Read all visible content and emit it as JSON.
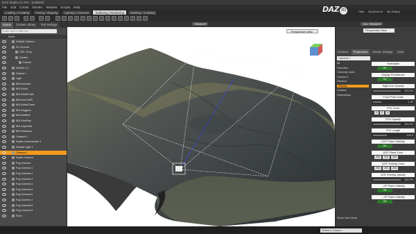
{
  "window": {
    "title": "DAZ Studio 4.x Pro - (untitled)"
  },
  "menu": [
    "File",
    "Edit",
    "Create",
    "Render",
    "Window",
    "Scripts",
    "Help"
  ],
  "main_tabs": [
    {
      "label": "Loading | Creating",
      "active": false
    },
    {
      "label": "Posing | Shaping",
      "active": false
    },
    {
      "label": "Lighting | Cameras",
      "active": false
    },
    {
      "label": "Surfacing | Rendering",
      "active": true
    },
    {
      "label": "Building | Scripting",
      "active": false
    }
  ],
  "logo": {
    "text": "DAZ",
    "badge": "3D"
  },
  "account": [
    "Help",
    "My Account",
    "My Gallery"
  ],
  "left_panel": {
    "tabs": [
      {
        "label": "Scene",
        "active": true
      },
      {
        "label": "Content Library",
        "active": false
      },
      {
        "label": "Tool Settings",
        "active": false
      }
    ],
    "filter_placeholder": "Enter text to filter by...",
    "header": "Node",
    "items": [
      {
        "label": "Default Camera",
        "indent": 1,
        "selected": false
      },
      {
        "label": "GL-Ground",
        "indent": 1,
        "selected": false
      },
      {
        "label": "CRT_Prop",
        "indent": 2,
        "selected": false
      },
      {
        "label": "Cavern",
        "indent": 2,
        "selected": false
      },
      {
        "label": "Cavern",
        "indent": 3,
        "selected": false
      },
      {
        "label": "Vehicle 4.2",
        "indent": 1,
        "selected": false
      },
      {
        "label": "Distant L",
        "indent": 1,
        "selected": false
      },
      {
        "label": "Light",
        "indent": 1,
        "selected": false
      },
      {
        "label": "IBS-Helmets",
        "indent": 1,
        "selected": false
      },
      {
        "label": "IBS-Scroll",
        "indent": 1,
        "selected": false
      },
      {
        "label": "IBS-DetailCuffL",
        "indent": 1,
        "selected": false
      },
      {
        "label": "IBS-ArmCuffR",
        "indent": 1,
        "selected": false
      },
      {
        "label": "IBS-DetailChest",
        "indent": 1,
        "selected": false
      },
      {
        "label": "IBS-Daggers",
        "indent": 1,
        "selected": false
      },
      {
        "label": "IBS-BeltBelt",
        "indent": 1,
        "selected": false
      },
      {
        "label": "IBS-ShinPad",
        "indent": 1,
        "selected": false
      },
      {
        "label": "IBS-CapeHair",
        "indent": 1,
        "selected": false
      },
      {
        "label": "IBS-Shadows",
        "indent": 1,
        "selected": false
      },
      {
        "label": "Camera 0",
        "indent": 1,
        "selected": false
      },
      {
        "label": "Depth-Commanded 1",
        "indent": 1,
        "selected": false
      },
      {
        "label": "Default Light 1",
        "indent": 1,
        "selected": false
      },
      {
        "label": "Camera 1",
        "indent": 1,
        "selected": true
      },
      {
        "label": "Depth Camera",
        "indent": 1,
        "selected": false
      },
      {
        "label": "Fog Camera",
        "indent": 1,
        "selected": false
      },
      {
        "label": "Fog Camera 1",
        "indent": 1,
        "selected": false
      },
      {
        "label": "Fog Camera 2",
        "indent": 1,
        "selected": false
      },
      {
        "label": "Fog Camera 3",
        "indent": 1,
        "selected": false
      },
      {
        "label": "Fog Camera 4",
        "indent": 1,
        "selected": false
      },
      {
        "label": "Fog Camera 5",
        "indent": 1,
        "selected": false
      },
      {
        "label": "Fog Camera 6",
        "indent": 1,
        "selected": false
      },
      {
        "label": "Fog Camera 7",
        "indent": 1,
        "selected": false
      },
      {
        "label": "Fog Camera 8",
        "indent": 1,
        "selected": false
      },
      {
        "label": "Fog Camera 9",
        "indent": 1,
        "selected": false
      },
      {
        "label": "Rock",
        "indent": 1,
        "selected": false
      }
    ]
  },
  "viewport": {
    "title": "Viewport",
    "view_select": "Perspective View"
  },
  "right_panel": {
    "title": "Aux Viewport",
    "view_select": "Perspective View",
    "tabs": [
      {
        "label": "Surfaces",
        "active": false
      },
      {
        "label": "Parameters",
        "active": true
      },
      {
        "label": "Render Settings",
        "active": false
      },
      {
        "label": "Anim",
        "active": false
      }
    ],
    "camera_select": "Camera 1",
    "categories": [
      {
        "label": "All",
        "sel": false
      },
      {
        "label": "Favorites",
        "sel": false
      },
      {
        "label": "Currently Used",
        "sel": false
      },
      {
        "label": "Camera 1",
        "sel": false
      },
      {
        "label": "General",
        "sel": false
      },
      {
        "label": "Display",
        "sel": true
      },
      {
        "label": "Camera",
        "sel": false
      },
      {
        "label": "Dimensions",
        "sel": false
      }
    ],
    "properties": [
      {
        "label": "Selectable",
        "kind": "toggle",
        "value": "On"
      },
      {
        "label": "Display Persistence",
        "kind": "toggle",
        "value": "On"
      },
      {
        "label": "Sight Line Opacity",
        "kind": "slider",
        "value": "100.0%",
        "level": 1.0
      },
      {
        "label": "Focal Point Scale",
        "kind": "slider",
        "value": "1.00",
        "level": 0.3
      },
      {
        "label": "FOV Color",
        "kind": "color",
        "value": [
          "0",
          "0",
          "0"
        ]
      },
      {
        "label": "FOV Opacity",
        "kind": "slider",
        "value": "100.0%",
        "level": 1.0
      },
      {
        "label": "FOV Length",
        "kind": "slider",
        "value": "100.0",
        "level": 0.5
      },
      {
        "label": "DOF Plane Visibility",
        "kind": "toggle",
        "value": "On"
      },
      {
        "label": "DOF Plane Color",
        "kind": "color",
        "value": [
          "255",
          "255",
          "255"
        ]
      },
      {
        "label": "DOF Overlay Color",
        "kind": "color",
        "value": [
          "255",
          "255",
          "255"
        ]
      },
      {
        "label": "DOF Overlay Opacity",
        "kind": "slider",
        "value": "100.0%",
        "level": 1.0
      },
      {
        "label": "...OF Plane Visibility",
        "kind": "toggle",
        "value": "Off"
      },
      {
        "label": "...OF Plane Visibility",
        "kind": "toggle",
        "value": "Off"
      }
    ],
    "show_sub_items": "Show Sub Items"
  },
  "status": {
    "lesson_select": "Select a Lesson..."
  }
}
